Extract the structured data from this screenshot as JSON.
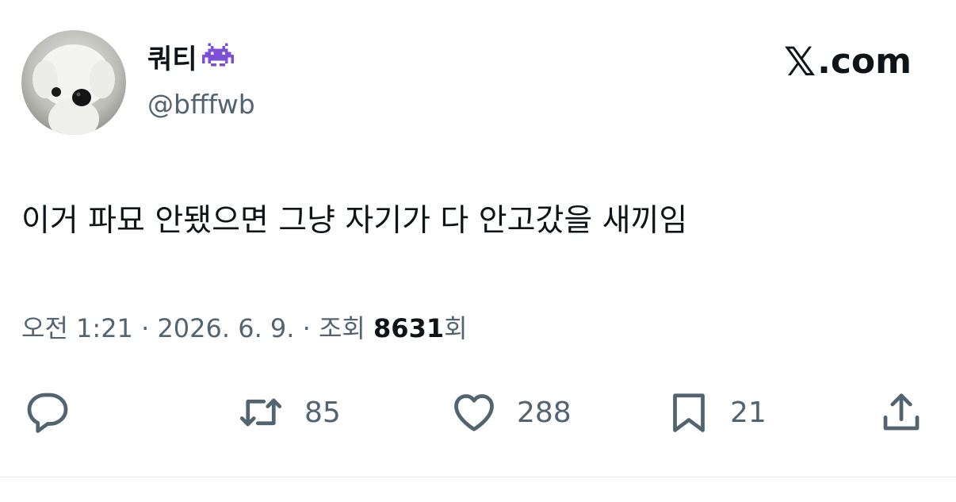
{
  "author": {
    "display_name": "쿼티",
    "handle": "@bfffwb",
    "badge_icon": "alien-monster-icon",
    "avatar_description_icon": "puppy-avatar"
  },
  "brand": {
    "mark": "𝕏",
    "domain": ".com"
  },
  "tweet": {
    "text": "이거 파묘 안됐으면 그냥 자기가 다 안고갔을 새끼임"
  },
  "meta": {
    "time": "오전 1:21",
    "separator": " · ",
    "date": "2026. 6. 9.",
    "views_label": "조회 ",
    "views_count": "8631",
    "views_suffix": "회"
  },
  "actions": {
    "reply_icon": "reply-icon",
    "retweet_icon": "retweet-icon",
    "retweet_count": "85",
    "like_icon": "heart-icon",
    "like_count": "288",
    "bookmark_icon": "bookmark-icon",
    "bookmark_count": "21",
    "share_icon": "share-icon"
  },
  "colors": {
    "text_primary": "#0f1419",
    "text_secondary": "#536471",
    "badge_purple": "#7b4fd6"
  }
}
